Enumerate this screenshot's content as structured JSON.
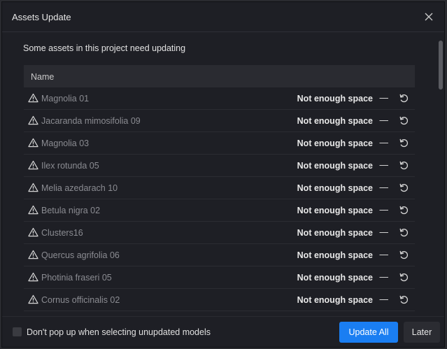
{
  "dialog": {
    "title": "Assets Update",
    "subtitle": "Some assets in this project need updating"
  },
  "table": {
    "header_name": "Name",
    "rows": [
      {
        "name": "Magnolia 01",
        "status": "Not enough space",
        "dash": "—"
      },
      {
        "name": "Jacaranda mimosifolia 09",
        "status": "Not enough space",
        "dash": "—"
      },
      {
        "name": "Magnolia 03",
        "status": "Not enough space",
        "dash": "—"
      },
      {
        "name": "Ilex rotunda 05",
        "status": "Not enough space",
        "dash": "—"
      },
      {
        "name": "Melia azedarach 10",
        "status": "Not enough space",
        "dash": "—"
      },
      {
        "name": "Betula nigra 02",
        "status": "Not enough space",
        "dash": "—"
      },
      {
        "name": "Clusters16",
        "status": "Not enough space",
        "dash": "—"
      },
      {
        "name": "Quercus agrifolia 06",
        "status": "Not enough space",
        "dash": "—"
      },
      {
        "name": "Photinia fraseri 05",
        "status": "Not enough space",
        "dash": "—"
      },
      {
        "name": "Cornus officinalis 02",
        "status": "Not enough space",
        "dash": "—"
      },
      {
        "name": "",
        "status": "",
        "dash": ""
      }
    ]
  },
  "footer": {
    "checkbox_label": "Don't pop up when selecting unupdated models",
    "checkbox_checked": false,
    "update_all_label": "Update All",
    "later_label": "Later"
  },
  "colors": {
    "accent": "#1a7ef2",
    "background": "#1e1f25",
    "header_bg": "#2a2b31",
    "muted_text": "#8b8c92"
  },
  "icons": {
    "close": "close-icon",
    "warning": "warning-icon",
    "retry": "retry-icon"
  }
}
